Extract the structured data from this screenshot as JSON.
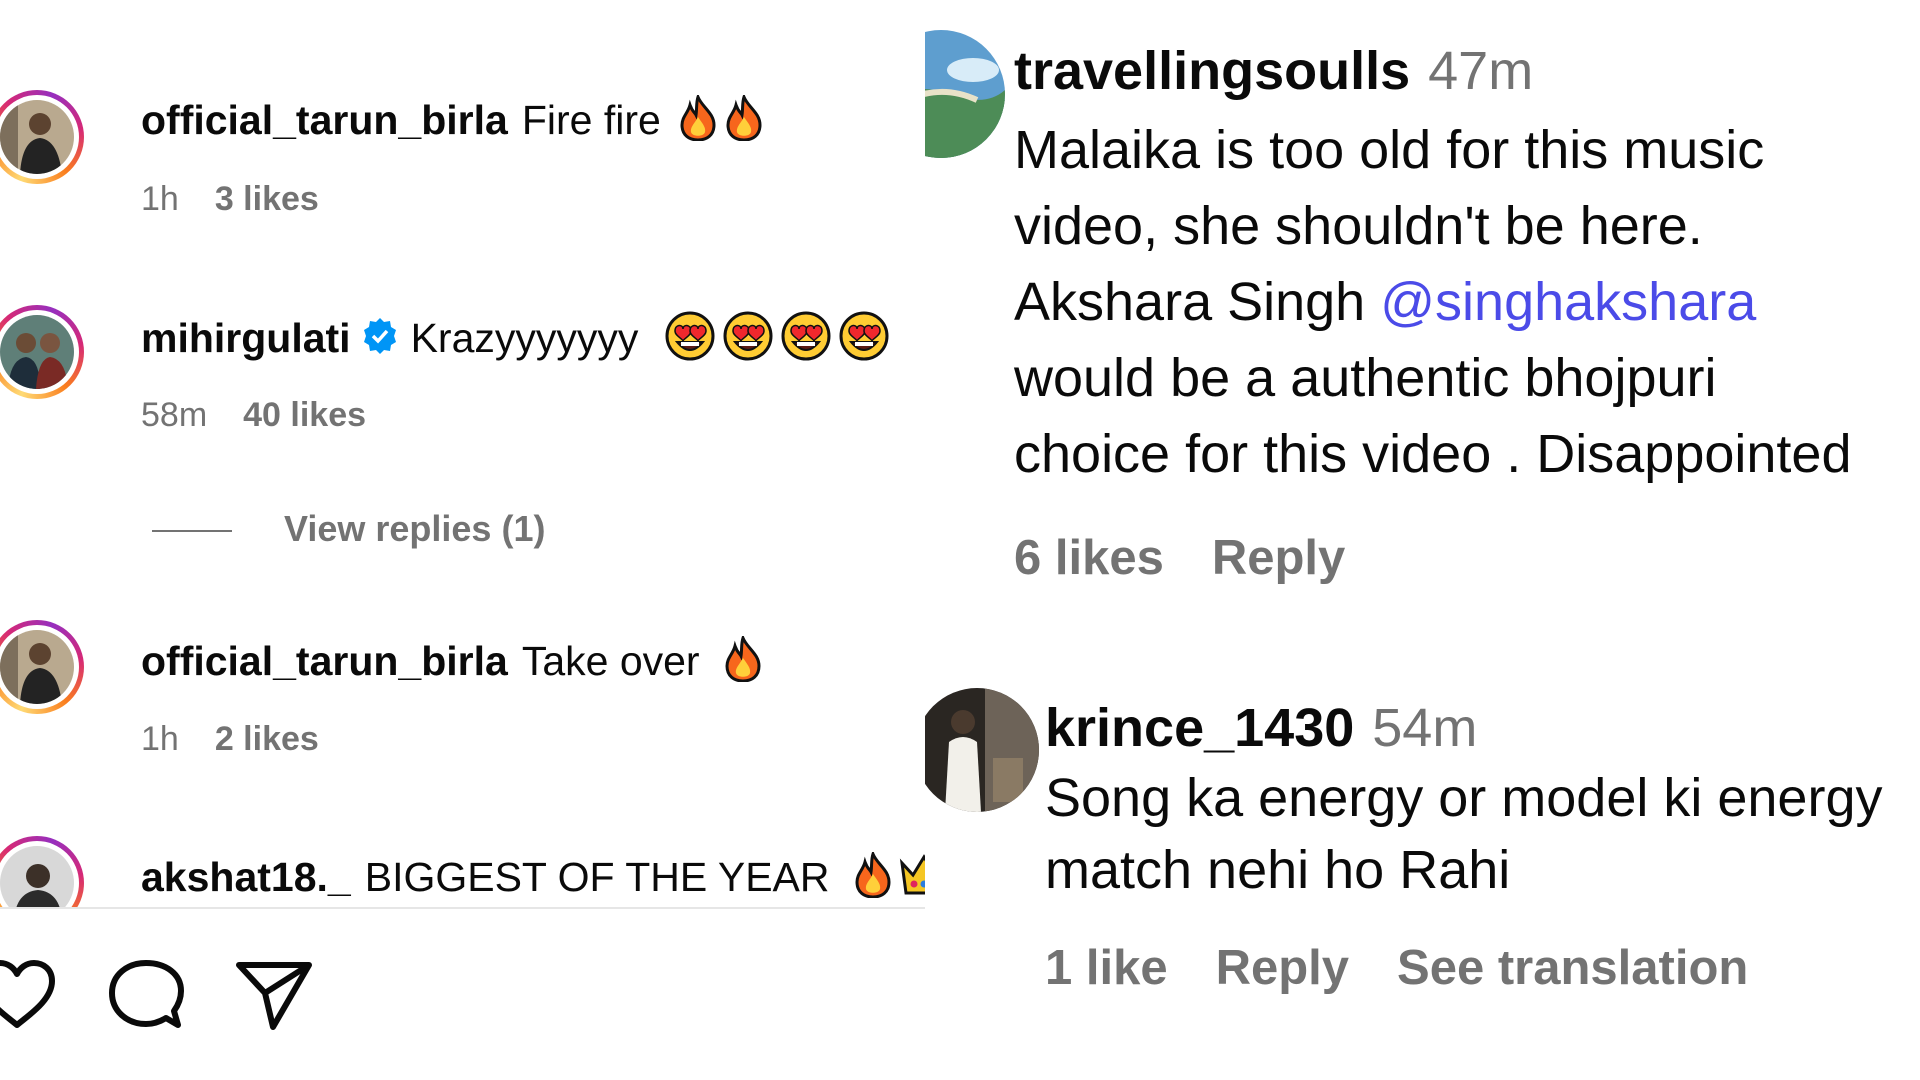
{
  "left_comments": [
    {
      "username": "official_tarun_birla",
      "text": "Fire fire",
      "emojis": [
        "fire",
        "fire"
      ],
      "time": "1h",
      "likes": "3 likes",
      "verified": false
    },
    {
      "username": "mihirgulati",
      "text": "Krazyyyyyyy",
      "emojis": [
        "heart-eyes",
        "heart-eyes",
        "heart-eyes",
        "heart-eyes"
      ],
      "time": "58m",
      "likes": "40 likes",
      "verified": true
    },
    {
      "username": "official_tarun_birla",
      "text": "Take over",
      "emojis": [
        "fire"
      ],
      "time": "1h",
      "likes": "2 likes",
      "verified": false
    },
    {
      "username": "akshat18._",
      "text": "BIGGEST OF THE YEAR",
      "emojis": [
        "fire",
        "crown"
      ],
      "verified": false
    }
  ],
  "view_replies": "View replies (1)",
  "actions": [
    "heart-icon",
    "comment-icon",
    "share-icon"
  ],
  "right_comments": [
    {
      "username": "travellingsoulls",
      "time": "47m",
      "lines": [
        "Malaika is too old for this music",
        "video, she shouldn't be here.",
        "Akshara Singh ",
        "would be a authentic bhojpuri",
        "choice for this video . Disappointed"
      ],
      "mention": "@singhakshara",
      "likes": "6 likes",
      "reply": "Reply"
    },
    {
      "username": "krince_1430",
      "time": "54m",
      "lines": [
        "Song ka energy or model ki energy",
        "match nehi ho Rahi"
      ],
      "likes": "1 like",
      "reply": "Reply",
      "translate": "See translation"
    }
  ],
  "colors": {
    "meta": "#737373",
    "mention": "#4b4be8",
    "verified": "#0095f6"
  }
}
